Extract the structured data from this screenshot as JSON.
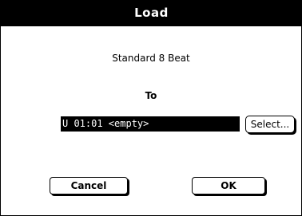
{
  "dialog": {
    "title": "Load",
    "source_name": "Standard 8 Beat",
    "to_label": "To",
    "target_value": "U 01:01 <empty>",
    "select_label": "Select...",
    "cancel_label": "Cancel",
    "ok_label": "OK"
  }
}
